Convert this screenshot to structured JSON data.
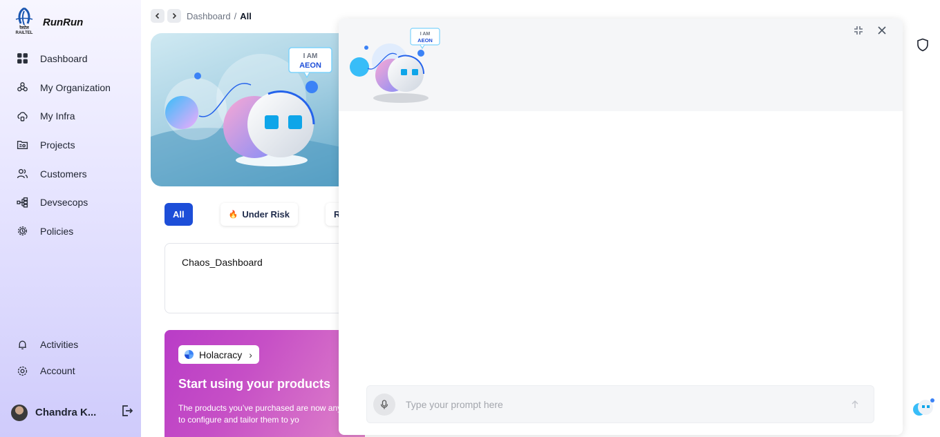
{
  "brand": {
    "name": "RunRun",
    "logo_text_line1": "रेलटेल",
    "logo_text_line2": "RAILTEL"
  },
  "sidebar": {
    "items": [
      {
        "label": "Dashboard",
        "icon": "grid-icon"
      },
      {
        "label": "My Organization",
        "icon": "org-icon"
      },
      {
        "label": "My Infra",
        "icon": "infra-cloud-icon"
      },
      {
        "label": "Projects",
        "icon": "folder-icon"
      },
      {
        "label": "Customers",
        "icon": "users-icon"
      },
      {
        "label": "Devsecops",
        "icon": "pipeline-icon"
      },
      {
        "label": "Policies",
        "icon": "settings-shield-icon"
      }
    ],
    "bottom_items": [
      {
        "label": "Activities",
        "icon": "bell-icon"
      },
      {
        "label": "Account",
        "icon": "gear-icon"
      }
    ],
    "user": {
      "name": "Chandra K..."
    }
  },
  "breadcrumb": {
    "parent": "Dashboard",
    "separator": "/",
    "current": "All"
  },
  "banner": {
    "bubble_line1": "I AM",
    "bubble_line2": "AEON"
  },
  "filters": {
    "items": [
      {
        "label": "All",
        "active": true
      },
      {
        "label": "Under Risk",
        "active": false,
        "icon": "fire-icon"
      },
      {
        "label": "Re",
        "active": false
      }
    ]
  },
  "dashboard_card": {
    "title": "Chaos_Dashboard"
  },
  "promo": {
    "pill_label": "Holacracy",
    "title": "Start using your products",
    "text": "The products you’ve purchased are now anytime to configure and tailor them to yo"
  },
  "chat": {
    "bubble_line1": "I AM",
    "bubble_line2": "AEON",
    "prompt_placeholder": "Type your prompt here",
    "prompt_value": ""
  },
  "colors": {
    "accent": "#1d4ed8",
    "sidebar_bottom": "#cfcbfb",
    "promo": "#c64fc6"
  }
}
